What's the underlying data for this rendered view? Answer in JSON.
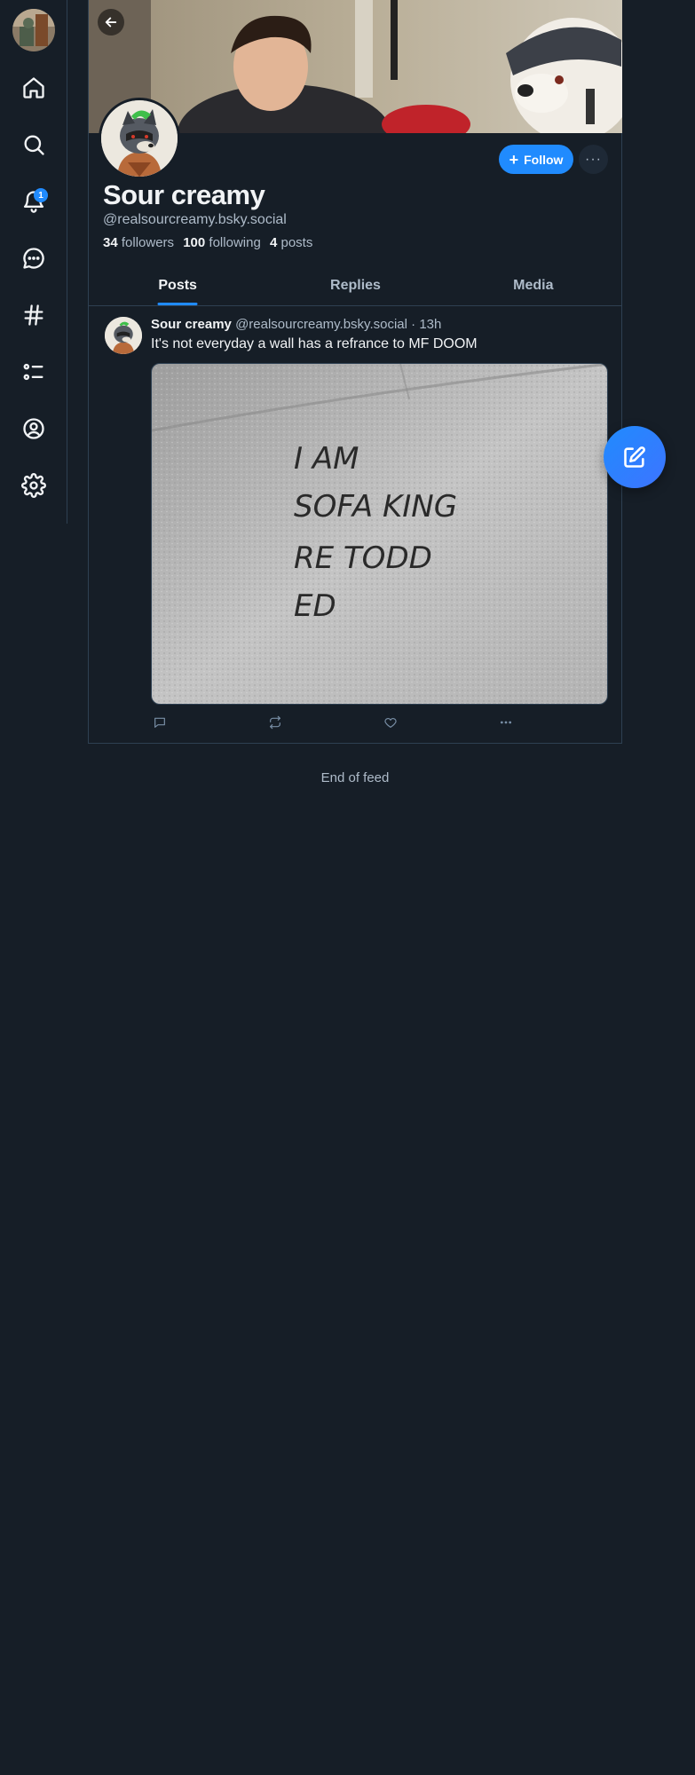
{
  "nav": {
    "items": [
      {
        "name": "home",
        "icon": "home-icon"
      },
      {
        "name": "search",
        "icon": "search-icon"
      },
      {
        "name": "notifications",
        "icon": "bell-icon",
        "badge": "1"
      },
      {
        "name": "chat",
        "icon": "chat-bubble-icon"
      },
      {
        "name": "feeds",
        "icon": "hashtag-icon"
      },
      {
        "name": "lists",
        "icon": "list-icon"
      },
      {
        "name": "profile",
        "icon": "user-circle-icon"
      },
      {
        "name": "settings",
        "icon": "gear-icon"
      }
    ]
  },
  "profile": {
    "display_name": "Sour creamy",
    "handle": "@realsourcreamy.bsky.social",
    "followers_count": "34",
    "followers_label": "followers",
    "following_count": "100",
    "following_label": "following",
    "posts_count": "4",
    "posts_label": "posts",
    "follow_label": "Follow",
    "more_label": "···"
  },
  "tabs": [
    {
      "label": "Posts",
      "active": true
    },
    {
      "label": "Replies",
      "active": false
    },
    {
      "label": "Media",
      "active": false
    }
  ],
  "post": {
    "author_name": "Sour creamy",
    "author_handle": "@realsourcreamy.bsky.social",
    "separator": "·",
    "time": "13h",
    "text": "It's not everyday a wall has a refrance to MF DOOM",
    "image_text": [
      "I AM",
      "SOFA KING",
      "RE TODD",
      "ED"
    ]
  },
  "feed": {
    "end_label": "End of feed"
  },
  "colors": {
    "background": "#161e27",
    "accent": "#208bfe",
    "border": "#2e4052",
    "muted_text": "#aebbc9"
  }
}
